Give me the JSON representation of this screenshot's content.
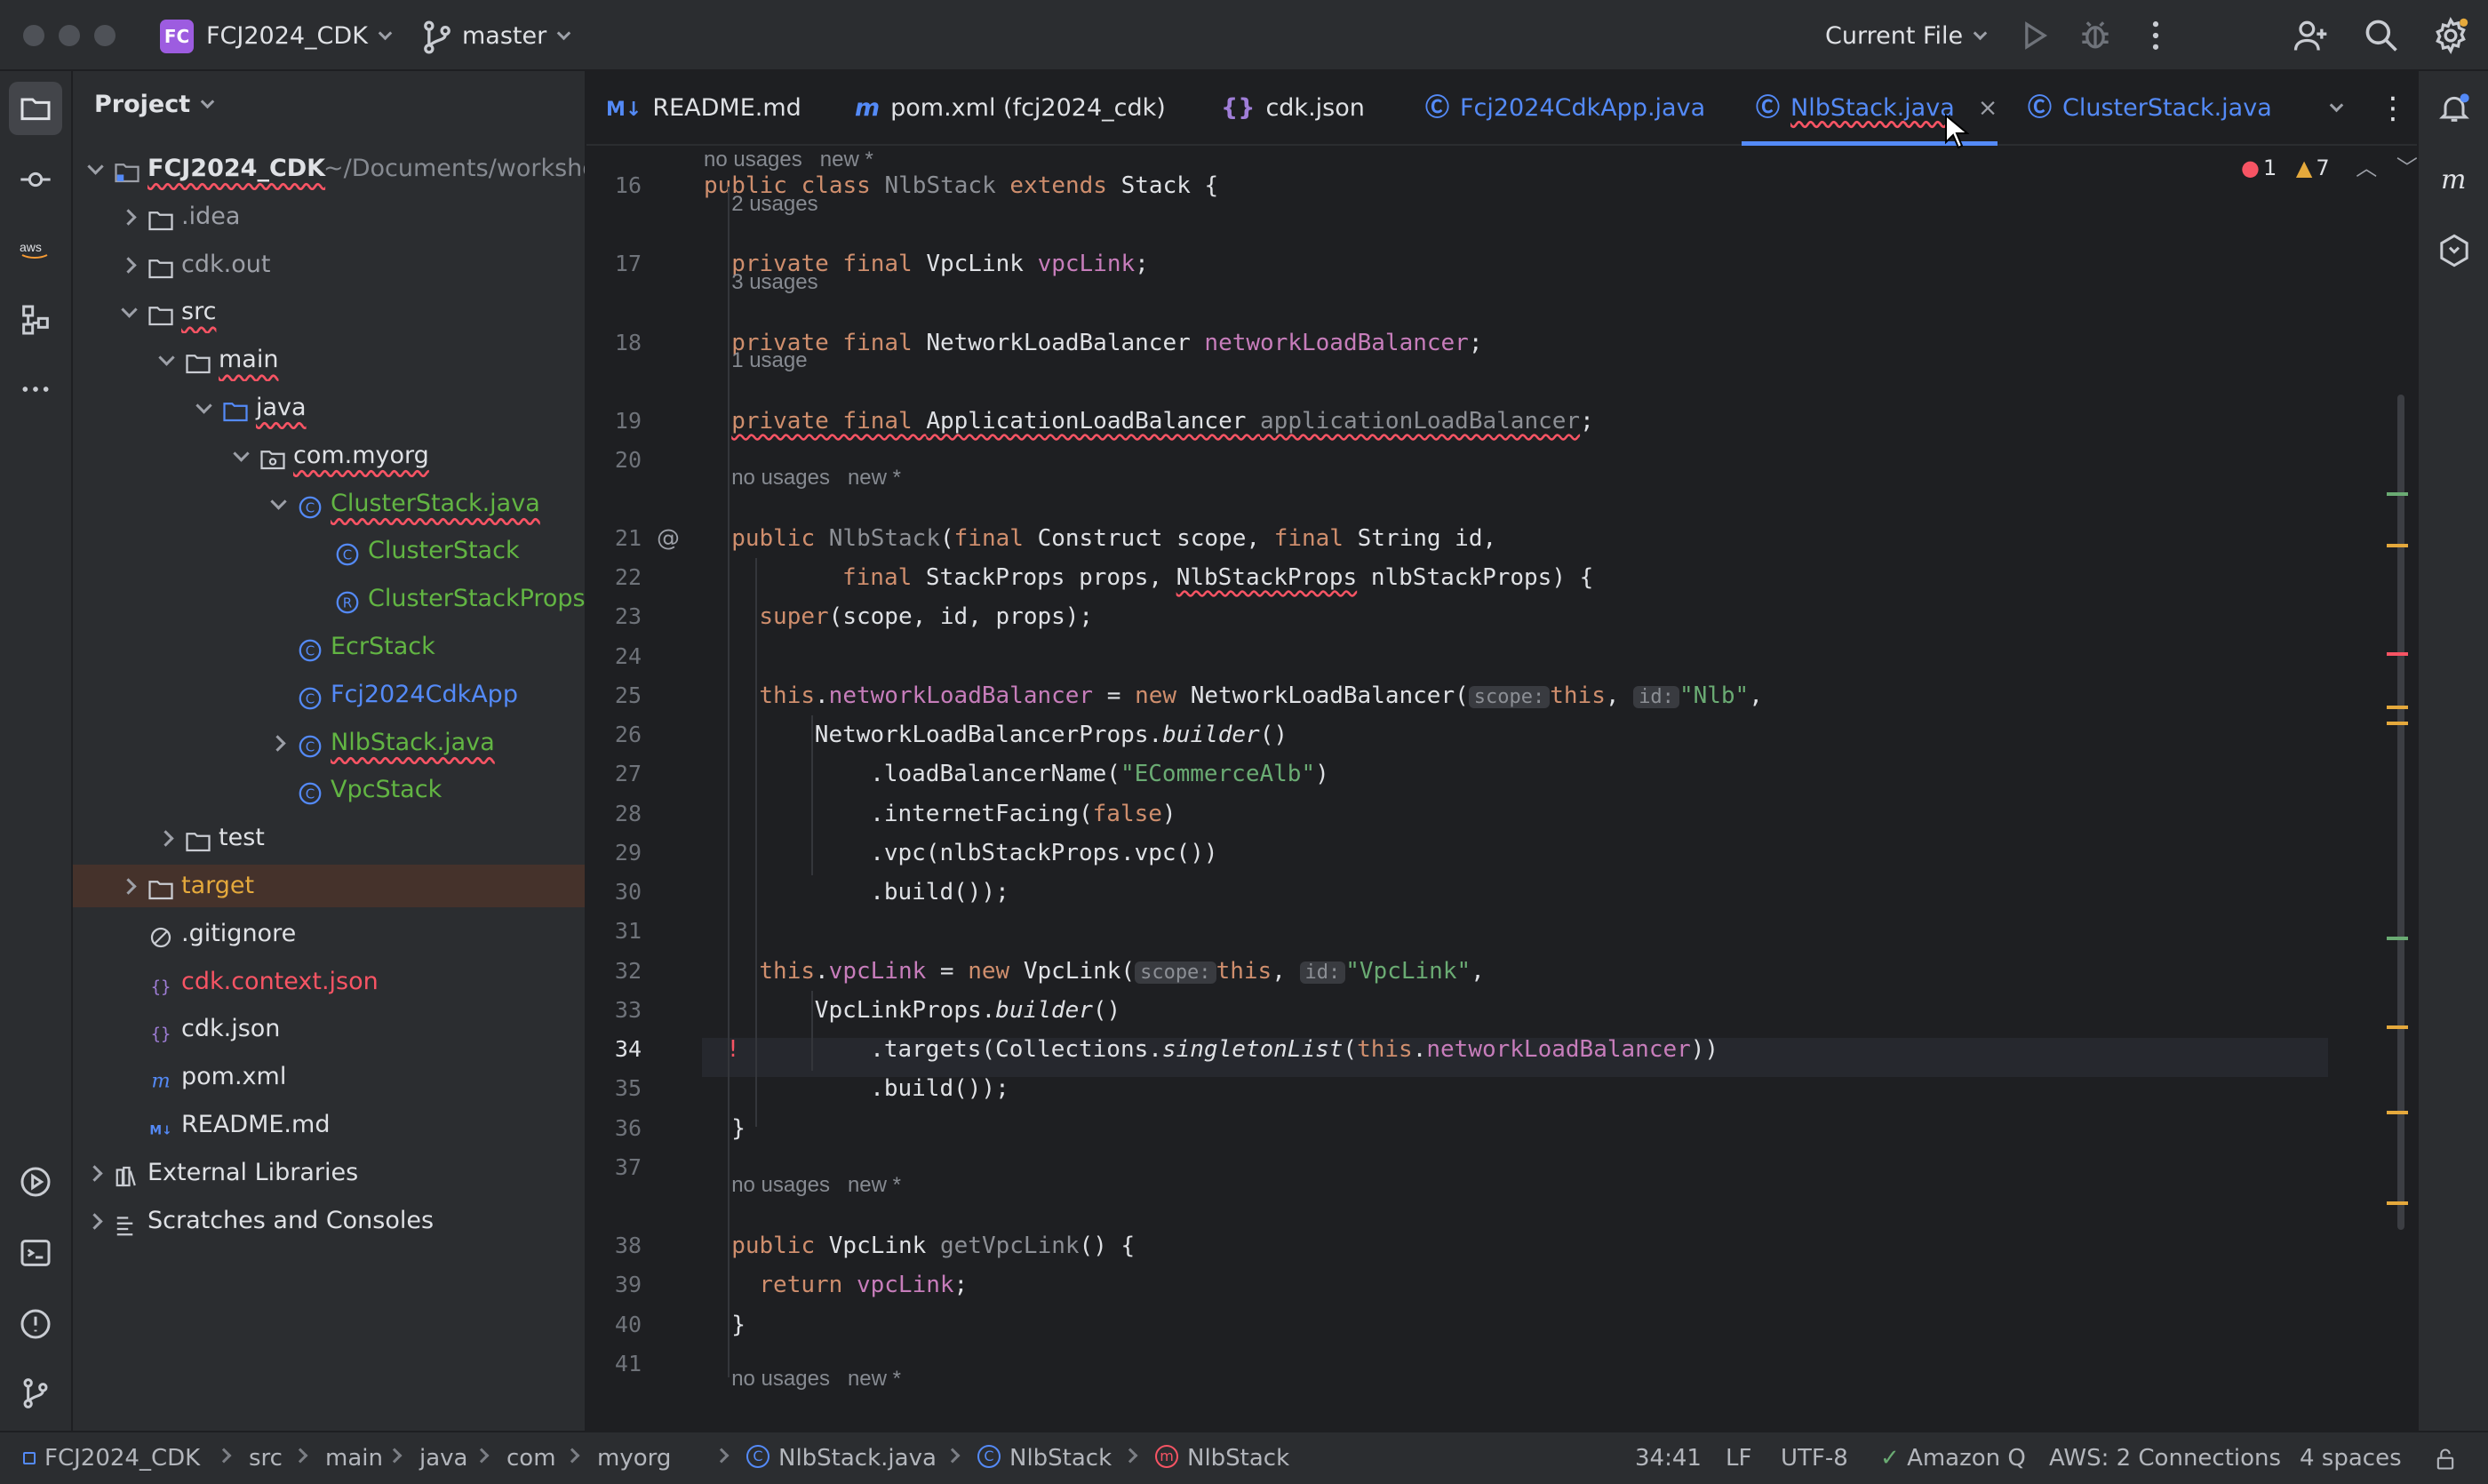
{
  "window": {
    "project_badge": "FC",
    "project_name": "FCJ2024_CDK",
    "branch": "master",
    "run_config": "Current File"
  },
  "project_panel": {
    "title": "Project",
    "root_name": "FCJ2024_CDK",
    "root_path": "~/Documents/worksho",
    "items": [
      {
        "label": "FCJ2024_CDK",
        "depth": 0
      },
      {
        "label": ".idea"
      },
      {
        "label": "cdk.out"
      },
      {
        "label": "src"
      },
      {
        "label": "main"
      },
      {
        "label": "java"
      },
      {
        "label": "com.myorg"
      },
      {
        "label": "ClusterStack.java"
      },
      {
        "label": "ClusterStack"
      },
      {
        "label": "ClusterStackProps"
      },
      {
        "label": "EcrStack"
      },
      {
        "label": "Fcj2024CdkApp"
      },
      {
        "label": "NlbStack.java"
      },
      {
        "label": "VpcStack"
      },
      {
        "label": "test"
      },
      {
        "label": "target"
      },
      {
        "label": ".gitignore"
      },
      {
        "label": "cdk.context.json"
      },
      {
        "label": "cdk.json"
      },
      {
        "label": "pom.xml"
      },
      {
        "label": "README.md"
      },
      {
        "label": "External Libraries"
      },
      {
        "label": "Scratches and Consoles"
      }
    ]
  },
  "tabs": [
    {
      "label": "README.md",
      "icon": "M↓"
    },
    {
      "label": "pom.xml (fcj2024_cdk)",
      "icon": "m"
    },
    {
      "label": "cdk.json",
      "icon": "{}"
    },
    {
      "label": "Fcj2024CdkApp.java",
      "icon": "C"
    },
    {
      "label": "NlbStack.java",
      "icon": "C",
      "active": true
    },
    {
      "label": "ClusterStack.java",
      "icon": "C"
    }
  ],
  "inspections": {
    "errors": "1",
    "warnings": "7"
  },
  "hints": {
    "no_usages_new": "no usages   new *",
    "two_usages": "2 usages",
    "three_usages": "3 usages",
    "one_usage": "1 usage"
  },
  "line_numbers": [
    "16",
    "17",
    "18",
    "19",
    "20",
    "21",
    "22",
    "23",
    "24",
    "25",
    "26",
    "27",
    "28",
    "29",
    "30",
    "31",
    "32",
    "33",
    "34",
    "35",
    "36",
    "37",
    "38",
    "39",
    "40",
    "41"
  ],
  "code": {
    "l16": [
      "public class ",
      "NlbStack",
      " extends ",
      "Stack {"
    ],
    "l17": [
      "private final ",
      "VpcLink ",
      "vpcLink",
      ";"
    ],
    "l18": [
      "private final ",
      "NetworkLoadBalancer ",
      "networkLoadBalancer",
      ";"
    ],
    "l19": [
      "private final ",
      "ApplicationLoadBalancer ",
      "applicationLoadBalancer",
      ";"
    ],
    "l21": [
      "public ",
      "NlbStack",
      "(",
      "final ",
      "Construct scope, ",
      "final ",
      "String id,"
    ],
    "l22": [
      "final ",
      "StackProps props, ",
      "NlbStackProps",
      " nlbStackProps) {"
    ],
    "l23": [
      "super",
      "(scope, id, props);"
    ],
    "l25": [
      "this",
      ".",
      "networkLoadBalancer",
      " = ",
      "new ",
      "NetworkLoadBalancer(",
      "scope:",
      "this",
      ", ",
      "id:",
      "\"Nlb\"",
      ","
    ],
    "l26": [
      "NetworkLoadBalancerProps.",
      "builder",
      "()"
    ],
    "l27": [
      ".loadBalancerName(",
      "\"ECommerceAlb\"",
      ")"
    ],
    "l28": [
      ".internetFacing(",
      "false",
      ")"
    ],
    "l29": [
      ".vpc(nlbStackProps.vpc())"
    ],
    "l30": [
      ".build());"
    ],
    "l32": [
      "this",
      ".",
      "vpcLink",
      " = ",
      "new ",
      "VpcLink(",
      "scope:",
      "this",
      ", ",
      "id:",
      "\"VpcLink\"",
      ","
    ],
    "l33": [
      "VpcLinkProps.",
      "builder",
      "()"
    ],
    "l34": [
      ".targets(",
      "Collections",
      ".",
      "singletonList",
      "(",
      "this",
      ".",
      "networkLoadBalancer",
      "))"
    ],
    "l35": [
      ".build());"
    ],
    "l36": [
      "}"
    ],
    "l38": [
      "public ",
      "VpcLink ",
      "getVpcLink",
      "() {"
    ],
    "l39": [
      "return ",
      "vpcLink",
      ";"
    ],
    "l40": [
      "}"
    ]
  },
  "statusbar": {
    "breadcrumb": [
      "FCJ2024_CDK",
      "src",
      "main",
      "java",
      "com",
      "myorg",
      "NlbStack.java",
      "NlbStack",
      "NlbStack"
    ],
    "position": "34:41",
    "line_sep": "LF",
    "encoding": "UTF-8",
    "amazon_q": "Amazon Q",
    "aws": "AWS: 2 Connections",
    "indent": "4 spaces"
  },
  "colors": {
    "keyword": "#cf8e6d",
    "field": "#c77dbb",
    "string": "#6aab73",
    "class_icon": "#548af7",
    "error": "#f75464",
    "warning": "#e5a93c"
  }
}
